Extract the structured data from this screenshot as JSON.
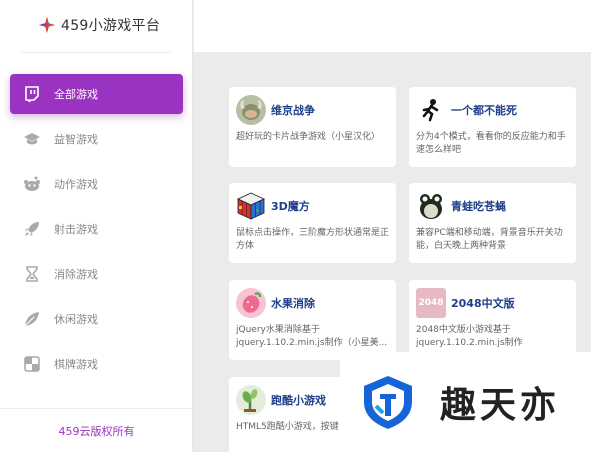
{
  "brand": {
    "title": "459小游戏平台"
  },
  "sidebar": {
    "items": [
      {
        "label": "全部游戏",
        "icon": "twitch-icon",
        "active": true
      },
      {
        "label": "益智游戏",
        "icon": "graduation-cap-icon",
        "active": false
      },
      {
        "label": "动作游戏",
        "icon": "reddit-icon",
        "active": false
      },
      {
        "label": "射击游戏",
        "icon": "rocket-icon",
        "active": false
      },
      {
        "label": "消除游戏",
        "icon": "hourglass-icon",
        "active": false
      },
      {
        "label": "休闲游戏",
        "icon": "leaf-icon",
        "active": false
      },
      {
        "label": "棋牌游戏",
        "icon": "board-game-icon",
        "active": false
      }
    ],
    "footer": "459云版权所有"
  },
  "cards": [
    {
      "title": "维京战争",
      "desc": "超好玩的卡片战争游戏（小星汉化）",
      "icon": "viking-helmet-icon"
    },
    {
      "title": "一个都不能死",
      "desc": "分为4个模式，看看你的反应能力和手速怎么样吧",
      "icon": "running-man-icon"
    },
    {
      "title": "3D魔方",
      "desc": "鼠标点击操作，三阶魔方形状通常是正方体",
      "icon": "rubiks-cube-icon"
    },
    {
      "title": "青蛙吃苍蝇",
      "desc": "兼容PC端和移动端，背景音乐开关功能，白天晚上两种背景",
      "icon": "frog-icon"
    },
    {
      "title": "水果消除",
      "desc": "jQuery水果消除基于jquery.1.10.2.min.js制作（小星美...",
      "icon": "fruit-icon"
    },
    {
      "title": "2048中文版",
      "desc": "2048中文版小游戏基于jquery.1.10.2.min.js制作",
      "icon": "2048-icon",
      "badge": "2048"
    },
    {
      "title": "跑酷小游戏",
      "desc": "HTML5跑酷小游戏，按键",
      "icon": "plant-runner-icon"
    }
  ],
  "watermark": {
    "text": "趣天亦"
  },
  "colors": {
    "accent": "#9b33c2",
    "card_title": "#1f3f8a"
  }
}
